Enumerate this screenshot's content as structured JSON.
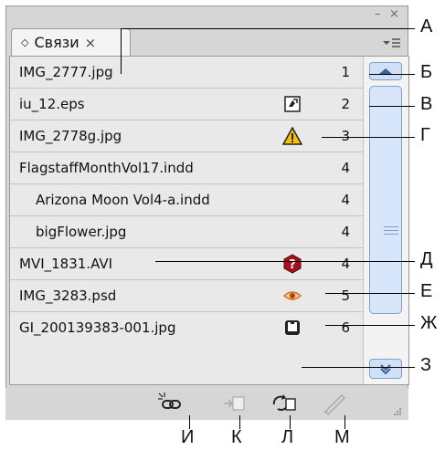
{
  "panel": {
    "tab_label": "Связи",
    "tab_close": "×",
    "window_controls": [
      "–",
      "×"
    ]
  },
  "links": [
    {
      "name": "IMG_2777.jpg",
      "page": "1",
      "icon": "",
      "sub": false
    },
    {
      "name": "iu_12.eps",
      "page": "2",
      "icon": "modified-icon",
      "sub": false
    },
    {
      "name": "IMG_2778g.jpg",
      "page": "3",
      "icon": "warning-icon",
      "sub": false
    },
    {
      "name": "FlagstaffMonthVol17.indd",
      "page": "4",
      "icon": "",
      "sub": false
    },
    {
      "name": "Arizona Moon Vol4-a.indd",
      "page": "4",
      "icon": "",
      "sub": true
    },
    {
      "name": "bigFlower.jpg",
      "page": "4",
      "icon": "",
      "sub": true
    },
    {
      "name": "MVI_1831.AVI",
      "page": "4",
      "icon": "missing-icon",
      "sub": false
    },
    {
      "name": "IMG_3283.psd",
      "page": "5",
      "icon": "layer-visibility-icon",
      "sub": false
    },
    {
      "name": "GI_200139383-001.jpg",
      "page": "6",
      "icon": "embedded-icon",
      "sub": false
    }
  ],
  "bottom_buttons": [
    {
      "icon": "relink-icon"
    },
    {
      "icon": "go-to-link-icon"
    },
    {
      "icon": "update-link-icon"
    },
    {
      "icon": "edit-original-icon"
    }
  ],
  "callouts": {
    "right": [
      "А",
      "Б",
      "В",
      "Г",
      "Д",
      "Е",
      "Ж",
      "З"
    ],
    "bottom": [
      "И",
      "К",
      "Л",
      "М"
    ]
  },
  "colors": {
    "warning": "#f2c200",
    "missing": "#a3111b",
    "eye": "#d9701a",
    "scroll": "#7f9fcf"
  }
}
